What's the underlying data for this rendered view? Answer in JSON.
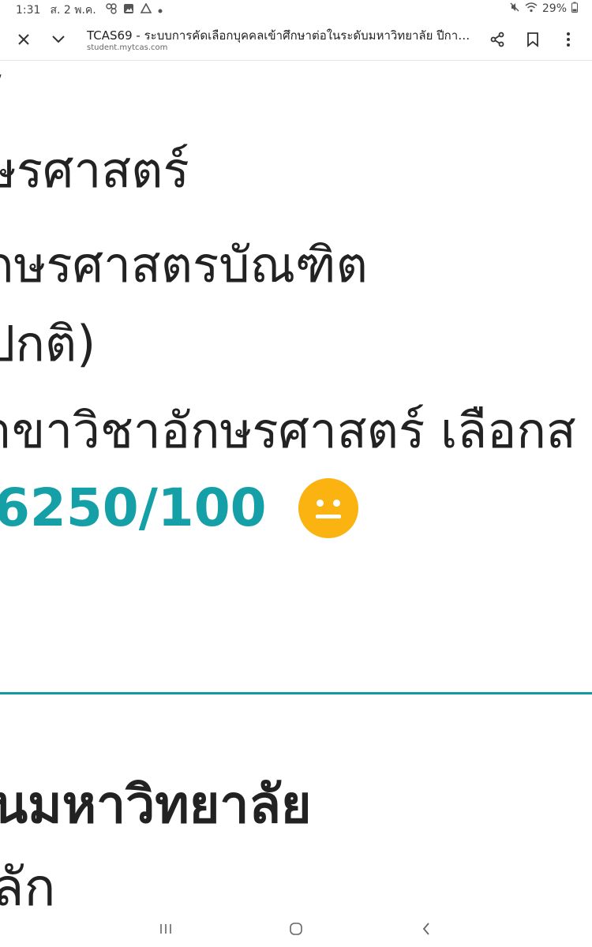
{
  "status_bar": {
    "time": "1:31",
    "date": "ส. 2 พ.ค.",
    "battery": "29%",
    "icons": [
      "pinwheel-icon",
      "gallery-icon",
      "drive-icon",
      "dot-icon",
      "mute-icon",
      "wifi-icon",
      "battery-icon"
    ]
  },
  "toolbar": {
    "title": "TCAS69 - ระบบการคัดเลือกบุคคลเข้าศึกษาต่อในระดับมหาวิทยาลัย ปีการศึก...",
    "url": "student.mytcas.com",
    "icons": [
      "close-icon",
      "chevron-down-icon",
      "share-icon",
      "bookmark-icon",
      "more-vert-icon"
    ]
  },
  "content": {
    "lines": [
      "ร์",
      "ษรศาสตร์",
      "กษรศาสตรบัณฑิต",
      "ปกติ)",
      "าขาวิชาอักษรศาสตร์ เลือกส"
    ],
    "score": "6250/100",
    "score_icon": "neutral-face-icon",
    "university": "นมหาวิทยาลัย",
    "campus": "ลัก"
  },
  "colors": {
    "accent": "#14a0a6",
    "emoji": "#fab310",
    "text": "#222222"
  },
  "navbar": {
    "icons": [
      "recent-apps-icon",
      "home-icon",
      "back-icon"
    ]
  }
}
